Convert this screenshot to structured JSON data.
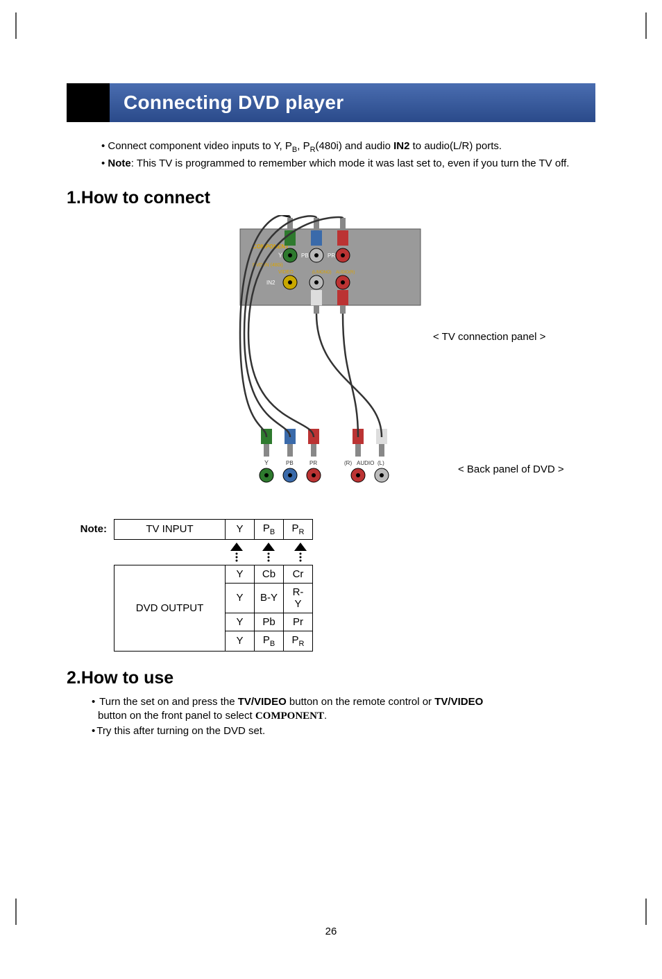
{
  "title": "Connecting DVD player",
  "intro": {
    "line1_pre": "Connect component video inputs to Y, P",
    "line1_b": "B",
    "line1_mid": ", P",
    "line1_r": "R",
    "line1_post": "(480i) and audio ",
    "line1_bold": "IN2",
    "line1_end": " to audio(L/R) ports.",
    "line2_bold": "Note",
    "line2_rest": ": This TV is programmed to remember which mode it was last set to, even if you turn the TV off."
  },
  "section1": "1.How to connect",
  "section2": "2.How to use",
  "diagram": {
    "tv_panel_label": "< TV connection panel >",
    "dvd_panel_label": "< Back panel of DVD >",
    "component_label": "COMPONENT",
    "dvd_in_label": "DVD IN (480i)",
    "y_label": "Y",
    "pb_label": "PB",
    "pr_label": "PR",
    "in2_label": "IN2",
    "video_label": "VIDEO",
    "audio_lmono_label": "(L/MONO)",
    "audio_r_label": "AUDIO(R)",
    "dvd_y": "Y",
    "dvd_pb": "PB",
    "dvd_pr": "PR",
    "dvd_r": "(R)",
    "dvd_audio": "AUDIO",
    "dvd_l": "(L)"
  },
  "note_label": "Note:",
  "table": {
    "tv_input": "TV INPUT",
    "dvd_output": "DVD OUTPUT",
    "y": "Y",
    "pb": "PB",
    "pr": "PR",
    "cb": "Cb",
    "cr": "Cr",
    "by": "B-Y",
    "ry": "R-Y",
    "pb2": "Pb",
    "pr2": "Pr"
  },
  "howto": {
    "l1a": "Turn the set on and press the ",
    "l1b": "TV/VIDEO",
    "l1c": " button on the remote control or ",
    "l1d": "TV/VIDEO",
    "l1e": " button on the front panel to select ",
    "l1f": "COMPONENT",
    "l1g": ".",
    "l2": "Try this after turning on the DVD set."
  },
  "page_number": "26"
}
